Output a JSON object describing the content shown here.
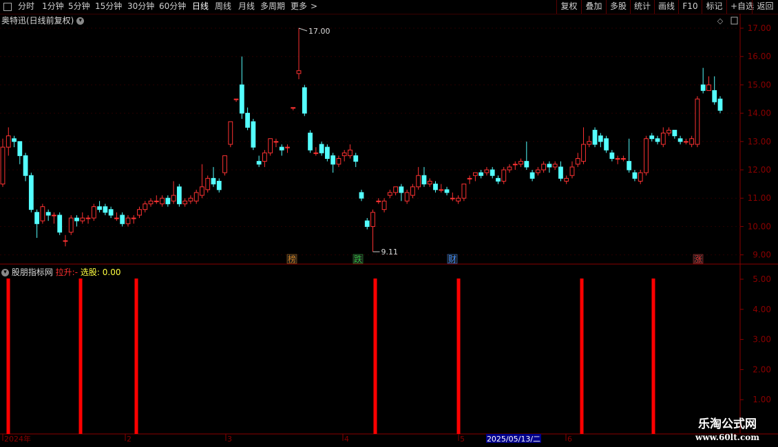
{
  "toolbar": {
    "periods": [
      "分时",
      "1分钟",
      "5分钟",
      "15分钟",
      "30分钟",
      "60分钟",
      "日线",
      "周线",
      "月线",
      "多周期",
      "更多"
    ],
    "active_period": "日线",
    "more_arrow": ">",
    "right_buttons": [
      "复权",
      "叠加",
      "多股",
      "统计",
      "画线",
      "F10",
      "标记",
      "+自选",
      "返回"
    ]
  },
  "main_panel": {
    "stock_title": "奥特迅(日线前复权)",
    "high_label": "17.00",
    "low_label": "9.11",
    "y_ticks": [
      "17.00",
      "16.00",
      "15.00",
      "14.00",
      "13.00",
      "12.00",
      "11.00",
      "10.00",
      "9.00"
    ],
    "event_markers": [
      {
        "text": "榜",
        "color": "#d08020"
      },
      {
        "text": "跌",
        "color": "#30c040"
      },
      {
        "text": "财",
        "color": "#4090ff"
      },
      {
        "text": "涨",
        "color": "#e03030"
      }
    ]
  },
  "indicator_panel": {
    "name": "股朋指标网",
    "label1": "拉升:",
    "label1_value": "-",
    "label2": "选股:",
    "label2_value": "0.00",
    "y_ticks": [
      "5.00",
      "4.00",
      "3.00",
      "2.00",
      "1.00"
    ]
  },
  "date_axis": {
    "labels": [
      "2024年",
      "2",
      "3",
      "4",
      "5",
      "6"
    ],
    "cursor_date": "2025/05/13/二"
  },
  "logo": {
    "line1": "乐淘公式网",
    "line2": "www.60lt.com"
  },
  "colors": {
    "up": "#ff3232",
    "down": "#54ffff",
    "axis": "#8b0000",
    "background": "#000000",
    "signal": "#ff0000"
  },
  "chart_data": [
    {
      "type": "candlestick",
      "title": "奥特迅(日线前复权)",
      "ylim": [
        8.8,
        17.3
      ],
      "annotations": [
        {
          "label": "17.00",
          "value": 17.0
        },
        {
          "label": "9.11",
          "value": 9.11
        }
      ],
      "candles": [
        [
          11.5,
          12.8,
          13.1,
          11.4
        ],
        [
          12.8,
          13.2,
          13.5,
          12.5
        ],
        [
          13.1,
          13.0,
          13.2,
          12.8
        ],
        [
          13.0,
          12.5,
          13.0,
          12.2
        ],
        [
          12.5,
          11.8,
          12.6,
          11.6
        ],
        [
          11.8,
          10.6,
          11.9,
          10.5
        ],
        [
          10.5,
          10.1,
          10.6,
          9.6
        ],
        [
          10.2,
          10.7,
          10.8,
          10.1
        ],
        [
          10.5,
          10.4,
          10.6,
          10.2
        ],
        [
          10.4,
          10.4,
          10.5,
          10.1
        ],
        [
          10.4,
          9.8,
          10.5,
          9.7
        ],
        [
          9.5,
          9.5,
          9.7,
          9.3
        ],
        [
          9.8,
          10.3,
          10.4,
          9.7
        ],
        [
          10.3,
          10.2,
          10.4,
          10.0
        ],
        [
          10.2,
          10.3,
          10.5,
          10.1
        ],
        [
          10.3,
          10.3,
          10.4,
          10.1
        ],
        [
          10.3,
          10.7,
          10.8,
          10.2
        ],
        [
          10.7,
          10.6,
          10.9,
          10.5
        ],
        [
          10.7,
          10.5,
          10.8,
          10.4
        ],
        [
          10.6,
          10.4,
          10.7,
          10.3
        ],
        [
          10.3,
          10.3,
          10.5,
          10.2
        ],
        [
          10.4,
          10.1,
          10.5,
          10.0
        ],
        [
          10.1,
          10.3,
          10.4,
          10.0
        ],
        [
          10.3,
          10.3,
          10.4,
          10.1
        ],
        [
          10.4,
          10.6,
          10.7,
          10.3
        ],
        [
          10.6,
          10.8,
          10.9,
          10.5
        ],
        [
          10.8,
          10.9,
          11.0,
          10.7
        ],
        [
          10.9,
          10.9,
          11.1,
          10.8
        ],
        [
          10.8,
          11.0,
          11.1,
          10.7
        ],
        [
          11.0,
          10.8,
          11.1,
          10.7
        ],
        [
          10.9,
          11.1,
          11.6,
          10.8
        ],
        [
          11.4,
          10.8,
          11.5,
          10.7
        ],
        [
          10.8,
          10.9,
          11.0,
          10.7
        ],
        [
          10.9,
          11.0,
          11.1,
          10.8
        ],
        [
          10.9,
          11.2,
          11.3,
          10.8
        ],
        [
          11.1,
          11.4,
          12.2,
          11.0
        ],
        [
          11.3,
          11.7,
          11.8,
          11.2
        ],
        [
          11.7,
          11.5,
          12.1,
          11.4
        ],
        [
          11.6,
          11.3,
          11.7,
          11.2
        ],
        [
          11.9,
          12.5,
          12.5,
          11.8
        ],
        [
          12.9,
          13.7,
          13.7,
          12.8
        ],
        [
          14.5,
          14.5,
          14.5,
          14.4
        ],
        [
          15.0,
          14.0,
          16.0,
          13.8
        ],
        [
          14.0,
          13.5,
          14.2,
          13.4
        ],
        [
          13.7,
          12.8,
          13.8,
          12.7
        ],
        [
          12.3,
          12.2,
          12.5,
          12.1
        ],
        [
          12.3,
          12.6,
          12.7,
          12.1
        ],
        [
          12.6,
          13.1,
          13.1,
          12.5
        ],
        [
          13.0,
          13.0,
          13.1,
          12.8
        ],
        [
          12.8,
          12.7,
          12.9,
          12.5
        ],
        [
          12.8,
          12.8,
          12.9,
          12.6
        ],
        [
          14.2,
          14.2,
          14.2,
          14.1
        ],
        [
          15.4,
          15.5,
          17.0,
          15.2
        ],
        [
          14.9,
          14.0,
          15.0,
          13.9
        ],
        [
          13.3,
          12.7,
          13.4,
          12.6
        ],
        [
          12.6,
          12.6,
          12.8,
          12.5
        ],
        [
          12.9,
          12.6,
          13.0,
          12.5
        ],
        [
          12.8,
          12.4,
          12.9,
          12.3
        ],
        [
          12.5,
          12.2,
          12.6,
          11.9
        ],
        [
          12.2,
          12.4,
          12.5,
          12.1
        ],
        [
          12.5,
          12.6,
          12.7,
          12.3
        ],
        [
          12.5,
          12.7,
          12.9,
          12.4
        ],
        [
          12.5,
          12.3,
          12.6,
          12.1
        ],
        [
          11.2,
          11.0,
          11.3,
          10.9
        ],
        [
          10.2,
          10.0,
          10.3,
          9.9
        ],
        [
          10.0,
          10.5,
          10.6,
          9.11
        ],
        [
          10.9,
          10.9,
          11.0,
          10.8
        ],
        [
          10.6,
          10.9,
          11.0,
          10.5
        ],
        [
          11.1,
          11.2,
          11.3,
          11.0
        ],
        [
          11.2,
          11.4,
          11.4,
          11.1
        ],
        [
          11.4,
          11.2,
          11.5,
          10.9
        ],
        [
          10.9,
          11.2,
          11.3,
          10.8
        ],
        [
          11.1,
          11.4,
          11.5,
          11.0
        ],
        [
          11.4,
          11.8,
          12.1,
          11.3
        ],
        [
          11.8,
          11.5,
          12.1,
          11.4
        ],
        [
          11.5,
          11.6,
          11.7,
          11.4
        ],
        [
          11.5,
          11.3,
          11.6,
          11.2
        ],
        [
          11.3,
          11.3,
          11.5,
          11.2
        ],
        [
          11.3,
          11.2,
          11.4,
          11.1
        ],
        [
          11.0,
          11.0,
          11.2,
          10.9
        ],
        [
          10.9,
          11.0,
          11.1,
          10.8
        ],
        [
          11.0,
          11.5,
          11.5,
          10.9
        ],
        [
          11.7,
          11.7,
          11.8,
          11.5
        ],
        [
          11.8,
          11.9,
          11.9,
          11.6
        ],
        [
          11.9,
          11.8,
          12.0,
          11.7
        ],
        [
          11.9,
          12.0,
          12.1,
          11.8
        ],
        [
          12.0,
          11.8,
          12.1,
          11.7
        ],
        [
          11.7,
          11.6,
          11.8,
          11.5
        ],
        [
          11.6,
          12.0,
          12.1,
          11.5
        ],
        [
          12.0,
          12.1,
          12.2,
          11.9
        ],
        [
          12.2,
          12.2,
          12.3,
          12.0
        ],
        [
          12.2,
          12.3,
          12.4,
          12.1
        ],
        [
          12.3,
          12.1,
          13.0,
          12.0
        ],
        [
          11.9,
          11.7,
          12.0,
          11.6
        ],
        [
          11.9,
          12.0,
          12.1,
          11.8
        ],
        [
          12.0,
          12.2,
          12.3,
          11.9
        ],
        [
          12.2,
          12.1,
          12.3,
          11.9
        ],
        [
          12.1,
          12.2,
          12.3,
          12.0
        ],
        [
          12.1,
          11.7,
          12.3,
          11.6
        ],
        [
          11.6,
          11.7,
          11.8,
          11.5
        ],
        [
          11.8,
          12.1,
          12.3,
          11.7
        ],
        [
          12.2,
          12.4,
          12.6,
          12.1
        ],
        [
          12.3,
          12.9,
          13.5,
          12.2
        ],
        [
          12.9,
          13.0,
          13.2,
          12.8
        ],
        [
          13.4,
          12.9,
          13.5,
          12.8
        ],
        [
          13.2,
          13.0,
          13.3,
          12.8
        ],
        [
          13.1,
          12.7,
          13.2,
          12.6
        ],
        [
          12.6,
          12.4,
          12.7,
          12.3
        ],
        [
          12.4,
          12.4,
          12.5,
          12.2
        ],
        [
          12.4,
          12.4,
          12.5,
          12.3
        ],
        [
          12.3,
          12.0,
          13.1,
          11.9
        ],
        [
          11.9,
          11.7,
          12.0,
          11.6
        ],
        [
          11.6,
          11.9,
          12.0,
          11.5
        ],
        [
          11.9,
          13.1,
          13.2,
          11.8
        ],
        [
          13.2,
          13.1,
          13.3,
          13.0
        ],
        [
          13.1,
          13.0,
          13.2,
          12.9
        ],
        [
          12.9,
          13.3,
          13.5,
          12.8
        ],
        [
          13.3,
          13.4,
          13.5,
          13.2
        ],
        [
          13.4,
          13.2,
          13.4,
          13.1
        ],
        [
          13.1,
          13.0,
          13.2,
          12.9
        ],
        [
          13.0,
          13.0,
          13.1,
          12.9
        ],
        [
          12.9,
          13.1,
          13.2,
          12.8
        ],
        [
          12.9,
          14.5,
          14.6,
          12.8
        ],
        [
          15.0,
          14.8,
          15.6,
          14.7
        ],
        [
          14.8,
          15.0,
          15.3,
          14.8
        ],
        [
          14.8,
          14.4,
          15.3,
          14.3
        ],
        [
          14.5,
          14.1,
          14.6,
          14.0
        ]
      ]
    },
    {
      "type": "bar",
      "title": "股朋指标网",
      "ylim": [
        0,
        5.5
      ],
      "signal_value": 5,
      "signal_bar_count": 7
    }
  ]
}
